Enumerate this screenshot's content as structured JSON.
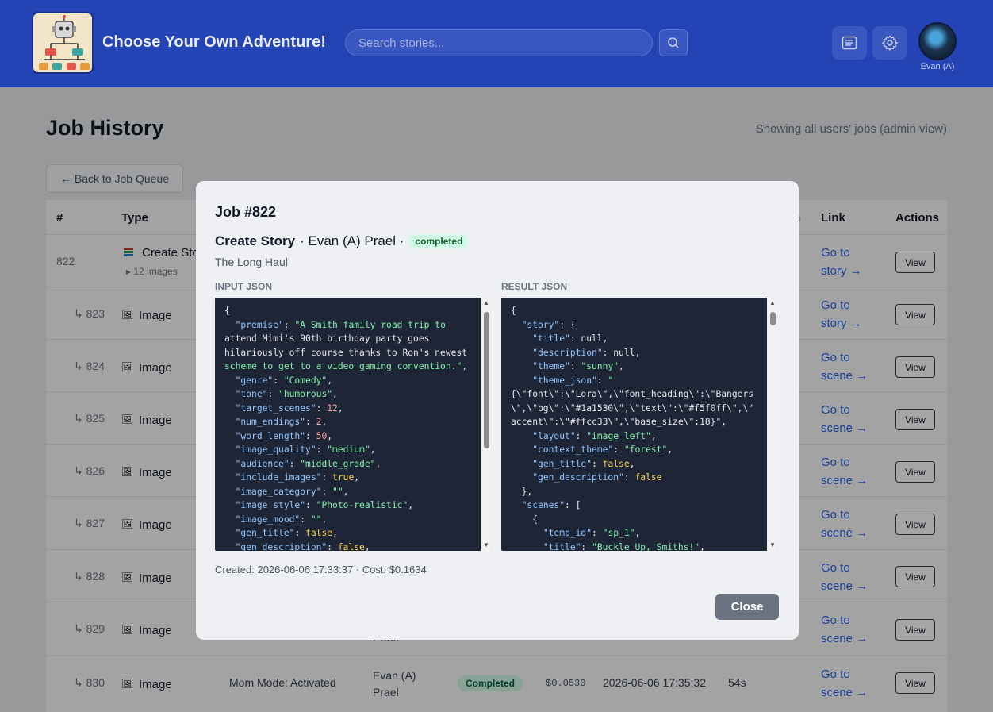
{
  "header": {
    "app_title": "Choose Your Own Adventure!",
    "search_placeholder": "Search stories...",
    "user_label": "Evan (A)"
  },
  "page": {
    "title": "Job History",
    "admin_note": "Showing all users' jobs (admin view)",
    "back_label": "← Back to Job Queue"
  },
  "table": {
    "headers": [
      "#",
      "Type",
      "n",
      "Link",
      "Actions"
    ],
    "rows": [
      {
        "id": "822",
        "type": "Create Sto",
        "sub": "12 images",
        "link1": "Go to",
        "link2": "story →",
        "view": "View"
      },
      {
        "id": "823",
        "type": "Image",
        "link1": "Go to",
        "link2": "story →",
        "view": "View"
      },
      {
        "id": "824",
        "type": "Image",
        "link1": "Go to",
        "link2": "scene →",
        "view": "View"
      },
      {
        "id": "825",
        "type": "Image",
        "link1": "Go to",
        "link2": "scene →",
        "view": "View"
      },
      {
        "id": "826",
        "type": "Image",
        "link1": "Go to",
        "link2": "scene →",
        "view": "View"
      },
      {
        "id": "827",
        "type": "Image",
        "link1": "Go to",
        "link2": "scene →",
        "view": "View"
      },
      {
        "id": "828",
        "type": "Image",
        "link1": "Go to",
        "link2": "scene →",
        "view": "View"
      },
      {
        "id": "829",
        "type": "Image",
        "user_partial": "Prael",
        "link1": "Go to",
        "link2": "scene →",
        "view": "View"
      },
      {
        "id": "830",
        "type": "Image",
        "title": "Mom Mode: Activated",
        "user1": "Evan (A)",
        "user2": "Prael",
        "status": "Completed",
        "cost": "$0.0530",
        "date": "2026-06-06 17:35:32",
        "duration": "54s",
        "link1": "Go to",
        "link2": "scene →",
        "view": "View"
      }
    ]
  },
  "modal": {
    "title": "Job #822",
    "type": "Create Story",
    "user": "· Evan (A) Prael ·",
    "status": "completed",
    "story_name": "The Long Haul",
    "input_label": "INPUT JSON",
    "result_label": "RESULT JSON",
    "meta": "Created: 2026-06-06 17:33:37 · Cost: $0.1634",
    "close_label": "Close",
    "input_lines": [
      "{",
      "  \"premise\": \"A Smith family road trip to",
      "attend Mimi's 90th birthday party goes",
      "hilariously off course thanks to Ron's newest",
      "scheme to get to a video gaming convention.\",",
      "  \"genre\": \"Comedy\",",
      "  \"tone\": \"humorous\",",
      "  \"target_scenes\": 12,",
      "  \"num_endings\": 2,",
      "  \"word_length\": 50,",
      "  \"image_quality\": \"medium\",",
      "  \"audience\": \"middle_grade\",",
      "  \"include_images\": true,",
      "  \"image_category\": \"\",",
      "  \"image_style\": \"Photo-realistic\",",
      "  \"image_mood\": \"\",",
      "  \"gen_title\": false,",
      "  \"gen_description\": false,"
    ],
    "result_lines": [
      "{",
      "  \"story\": {",
      "    \"title\": null,",
      "    \"description\": null,",
      "    \"theme\": \"sunny\",",
      "    \"theme_json\": \"",
      "{\\\"font\\\":\\\"Lora\\\",\\\"font_heading\\\":\\\"Bangers",
      "\\\",\\\"bg\\\":\\\"#1a1530\\\",\\\"text\\\":\\\"#f5f0ff\\\",\\\"",
      "accent\\\":\\\"#ffcc33\\\",\\\"base_size\\\":18}\",",
      "    \"layout\": \"image_left\",",
      "    \"context_theme\": \"forest\",",
      "    \"gen_title\": false,",
      "    \"gen_description\": false",
      "  },",
      "  \"scenes\": [",
      "    {",
      "      \"temp_id\": \"sp_1\",",
      "      \"title\": \"Buckle Up, Smiths!\","
    ]
  }
}
